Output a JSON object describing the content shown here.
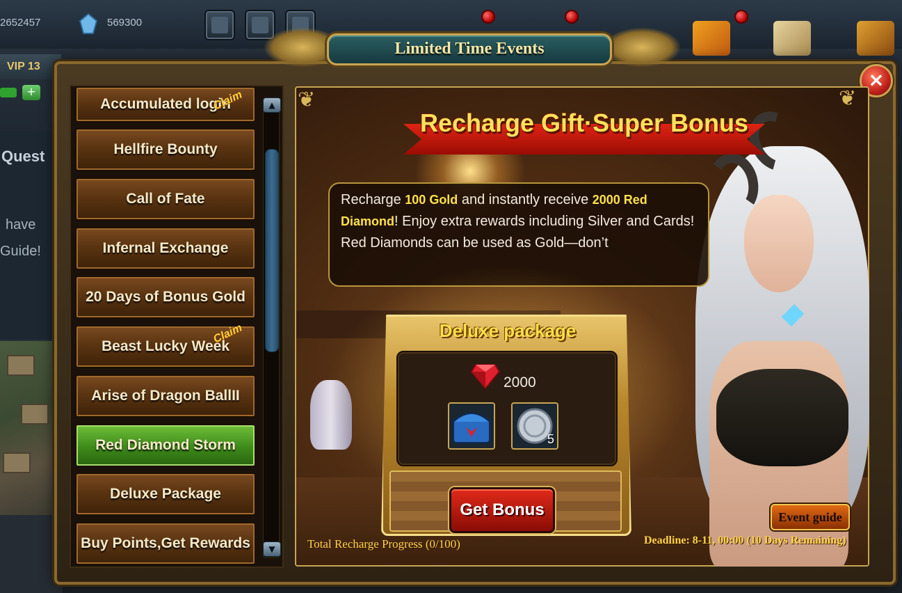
{
  "hud": {
    "gold_amount": "2652457",
    "diamond_amount": "569300",
    "vip_label": "VIP 13",
    "quest_label": "Quest",
    "side_text_1": "have",
    "side_text_2": "Guide!",
    "plus_label": "+"
  },
  "window": {
    "title": "Limited Time Events",
    "close_label": "×"
  },
  "sidebar": {
    "items": [
      {
        "label": "Accumulated login",
        "active": false,
        "claim": "Claim"
      },
      {
        "label": "Hellfire Bounty",
        "active": false
      },
      {
        "label": "Call of Fate",
        "active": false
      },
      {
        "label": "Infernal Exchange",
        "active": false
      },
      {
        "label": "20 Days of Bonus Gold",
        "active": false
      },
      {
        "label": "Beast Lucky Week",
        "active": false,
        "claim": "Claim"
      },
      {
        "label": "Arise of Dragon BallII",
        "active": false
      },
      {
        "label": "Red Diamond Storm",
        "active": true
      },
      {
        "label": "Deluxe Package",
        "active": false
      },
      {
        "label": "Buy Points,Get Rewards",
        "active": false
      }
    ],
    "scroll_up": "▲",
    "scroll_down": "▼"
  },
  "event": {
    "banner_title": "Recharge Gift·Super Bonus",
    "description": {
      "part1": "Recharge ",
      "gold_amount": "100 Gold",
      "part2": " and instantly receive ",
      "red_diamond_amount": "2000 Red Diamond",
      "part3": "! Enjoy extra rewards including Silver and Cards! Red Diamonds can be used as Gold—don’t"
    },
    "package_title": "Deluxe package",
    "package": {
      "red_diamond_count": "2000",
      "items": [
        {
          "icon": "chest-icon",
          "quantity": ""
        },
        {
          "icon": "silver-coin-icon",
          "quantity": "5"
        }
      ]
    },
    "get_bonus_label": "Get Bonus",
    "progress_text": "Total Recharge Progress (0/100)",
    "deadline_text": "Deadline: 8-11, 00:00 (10 Days Remaining)",
    "event_guide_label": "Event guide"
  },
  "colors": {
    "accent_gold": "#c9a552",
    "active_green": "#3d8a1a",
    "highlight_yellow": "#ffe14a",
    "button_red": "#c0201a"
  }
}
